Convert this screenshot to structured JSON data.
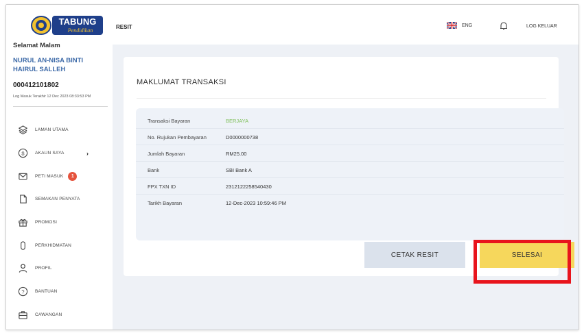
{
  "brand": {
    "logo_text": "TABUNG",
    "logo_sub": "Pendidikan"
  },
  "user": {
    "greeting": "Selamat Malam",
    "name": "NURUL AN-NISA BINTI HAIRUL SALLEH",
    "id": "000412101802",
    "last_login": "Log Masuk Terakhir 12 Dec 2023 08:33:53 PM"
  },
  "sidebar": {
    "items": [
      {
        "label": "LAMAN UTAMA",
        "icon": "layers-icon"
      },
      {
        "label": "AKAUN SAYA",
        "icon": "dollar-circle-icon",
        "chevron": "›"
      },
      {
        "label": "PETI MASUK",
        "icon": "mail-icon",
        "badge": "1"
      },
      {
        "label": "SEMAKAN PENYATA",
        "icon": "document-icon"
      },
      {
        "label": "PROMOSI",
        "icon": "gift-icon"
      },
      {
        "label": "PERKHIDMATAN",
        "icon": "capsule-icon"
      },
      {
        "label": "PROFIL",
        "icon": "user-icon"
      },
      {
        "label": "BANTUAN",
        "icon": "help-circle-icon"
      },
      {
        "label": "CAWANGAN",
        "icon": "briefcase-icon"
      }
    ]
  },
  "header": {
    "title": "RESIT",
    "language": "ENG",
    "logout": "LOG KELUAR"
  },
  "receipt": {
    "title": "MAKLUMAT TRANSAKSI",
    "rows": [
      {
        "label": "Transaksi Bayaran",
        "value": "BERJAYA"
      },
      {
        "label": "No. Rujukan Pembayaran",
        "value": "D0000000738"
      },
      {
        "label": "Jumlah Bayaran",
        "value": "RM25.00"
      },
      {
        "label": "Bank",
        "value": "SBI Bank A"
      },
      {
        "label": "FPX TXN ID",
        "value": "2312122258540430"
      },
      {
        "label": "Tarikh Bayaran",
        "value": "12-Dec-2023 10:59:46 PM"
      }
    ],
    "print_button": "CETAK RESIT",
    "done_button": "SELESAI"
  },
  "colors": {
    "accent_yellow": "#f6d75c",
    "success_green": "#7fbf5a",
    "name_blue": "#3d6aa8",
    "highlight_red": "#e8141c",
    "badge_red": "#e5533d"
  }
}
